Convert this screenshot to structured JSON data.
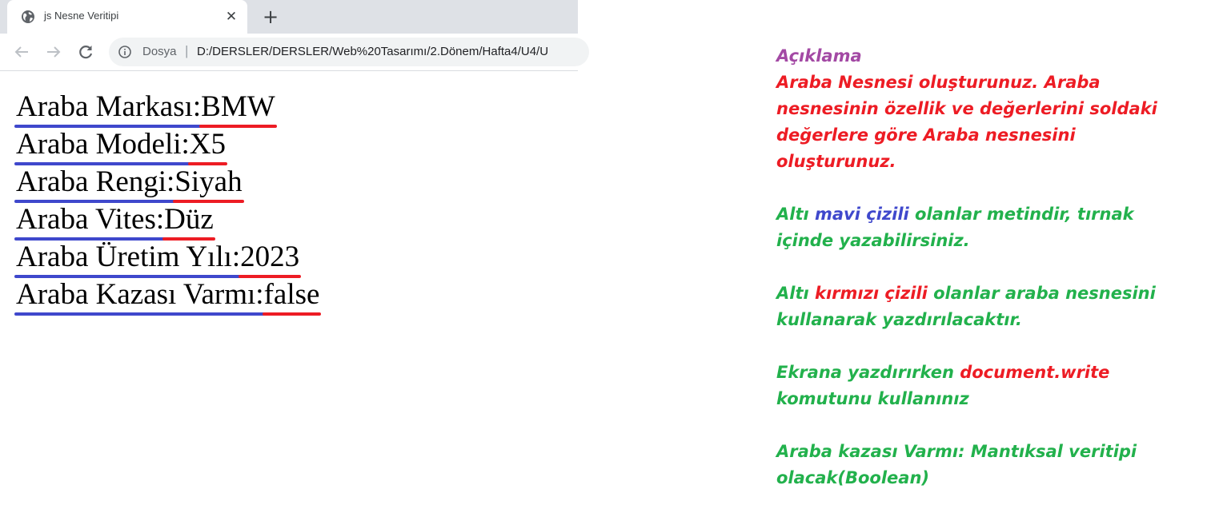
{
  "browser": {
    "tab_title": "js Nesne Veritipi",
    "tab_close": "✕",
    "new_tab": "+",
    "address_scheme": "Dosya",
    "address_separator": "|",
    "address_url": "D:/DERSLER/DERSLER/Web%20Tasarımı/2.Dönem/Hafta4/U4/U"
  },
  "page": {
    "rows": [
      {
        "label": "Araba Markası:",
        "value": "BMW"
      },
      {
        "label": "Araba Modeli:",
        "value": "X5"
      },
      {
        "label": "Araba Rengi:",
        "value": "Siyah"
      },
      {
        "label": "Araba Vites:",
        "value": "Düz"
      },
      {
        "label": "Araba Üretim Yılı:",
        "value": "2023"
      },
      {
        "label": "Araba Kazası Varmı:",
        "value": "false"
      }
    ]
  },
  "explanation": {
    "heading": "Açıklama",
    "task": "Araba Nesnesi oluşturunuz. Araba nesnesinin özellik ve değerlerini soldaki değerlere göre Araba nesnesini oluşturunuz.",
    "blue_note": {
      "prefix": "Altı ",
      "highlight": "mavi çizili",
      "suffix": " olanlar metindir, tırnak içinde yazabilirsiniz."
    },
    "red_note": {
      "prefix": "Altı ",
      "highlight": "kırmızı çizili",
      "suffix": " olanlar araba nesnesini kullanarak yazdırılacaktır."
    },
    "write_note": {
      "prefix": "Ekrana yazdırırken ",
      "highlight": "document.write",
      "suffix": " komutunu kullanınız"
    },
    "boolean_note": "Araba kazası Varmı: Mantıksal veritipi olacak(Boolean)"
  },
  "colors": {
    "heading": "#a349a4",
    "task": "#ed1c24",
    "note": "#22b14c",
    "text_underline": "#3f48cc",
    "value_underline": "#ed1c24"
  },
  "icons": [
    "globe-icon",
    "close-icon",
    "plus-icon",
    "back-arrow-icon",
    "forward-arrow-icon",
    "reload-icon",
    "info-icon"
  ]
}
